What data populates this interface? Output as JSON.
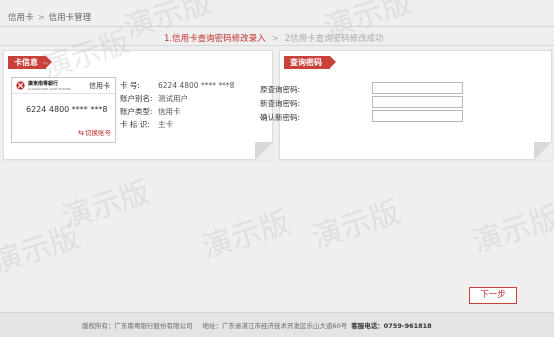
{
  "breadcrumb": {
    "item1": "信用卡",
    "sep": ">",
    "item2": "信用卡管理"
  },
  "steps": {
    "step1": "1.信用卡查询密码修改录入",
    "arrow": ">",
    "step2": "2信用卡查询密码修改成功"
  },
  "card_panel": {
    "tag": "卡信息",
    "card": {
      "bank_name": "廣東南粵銀行",
      "bank_name_en": "GUANGDONG NANYUE BANK",
      "type": "信用卡",
      "number": "6224 4800 **** ***8",
      "switch_label": "切换账号"
    },
    "info": [
      {
        "label": "卡    号:",
        "value": "6224 4800 **** ***8"
      },
      {
        "label": "账户别名:",
        "value": "测试用户"
      },
      {
        "label": "账户类型:",
        "value": "信用卡"
      },
      {
        "label": "卡 标 识:",
        "value": "主卡"
      }
    ]
  },
  "pwd_panel": {
    "tag": "查询密码",
    "fields": [
      {
        "label": "原查询密码:",
        "value": ""
      },
      {
        "label": "新查询密码:",
        "value": ""
      },
      {
        "label": "确认新密码:",
        "value": ""
      }
    ]
  },
  "next_button": "下一步",
  "watermark": "演示版",
  "footer": {
    "copyright": "版权所有：广东南粤银行股份有限公司",
    "address": "地址：广东省湛江市经济技术开发区乐山大道60号",
    "hotline": "客服电话：0759-961818"
  },
  "colors": {
    "accent": "#c9413a",
    "background": "#efefef",
    "panel": "#ffffff"
  },
  "icons": {
    "switch": "switch-arrows-icon",
    "bank_logo": "bank-logo-icon"
  }
}
